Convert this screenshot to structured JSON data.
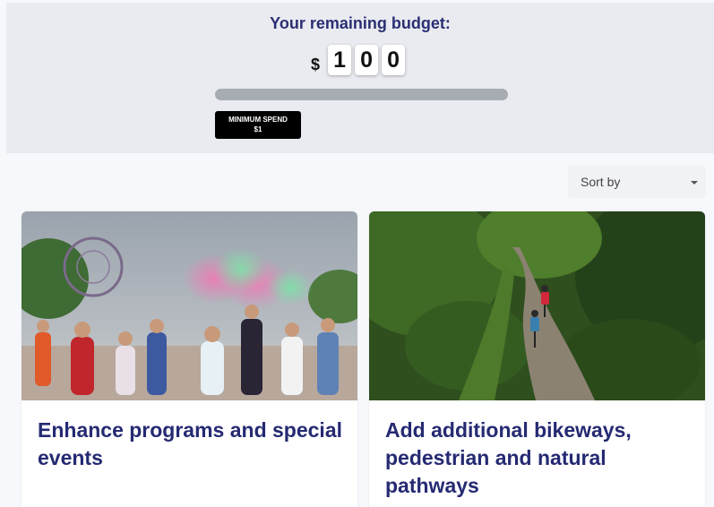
{
  "budget": {
    "title": "Your remaining budget:",
    "currency_symbol": "$",
    "digits": [
      "1",
      "0",
      "0"
    ],
    "progress_fraction": 0,
    "min_spend_label": "MINIMUM SPEND",
    "min_spend_value": "$1"
  },
  "sort": {
    "label": "Sort by"
  },
  "cards": [
    {
      "title": "Enhance programs and special events",
      "image": "festival-photo"
    },
    {
      "title": "Add additional bikeways, pedestrian and natural pathways",
      "image": "bike-path-photo"
    }
  ],
  "colors": {
    "title": "#2a2f73",
    "card_title": "#252a72",
    "panel": "#e9ebf0",
    "progress": "#a7acb3"
  }
}
